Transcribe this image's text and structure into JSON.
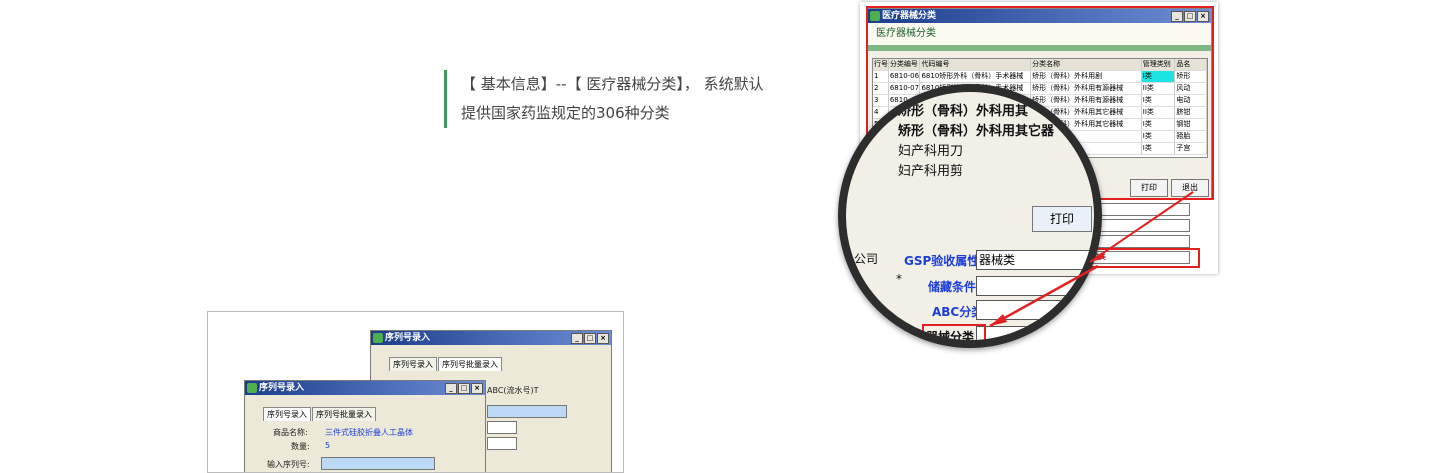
{
  "caption": {
    "line1": "【 基本信息】--【 医疗器械分类】， 系统默认",
    "line2": "提供国家药监规定的306种分类"
  },
  "right_window": {
    "title": "医疗器械分类",
    "header": "医疗器械分类",
    "columns": [
      "行号",
      "分类编号",
      "代码编号",
      "分类名称",
      "管理类别",
      "品名"
    ],
    "rows": [
      [
        "1",
        "6810-06",
        "6810矫形外科（骨科）手术器械",
        "矫形（骨科）外科用剧",
        "I类",
        "矫形"
      ],
      [
        "2",
        "6810-07",
        "6810矫形外科（骨科）手术器械",
        "矫形（骨科）外科用有源器械",
        "II类",
        "风动"
      ],
      [
        "3",
        "6810",
        "",
        "矫形（骨科）外科用有源器械",
        "I类",
        "电动"
      ],
      [
        "4",
        "",
        "",
        "矫形（骨科）外科用其它器械",
        "II类",
        "脐钳"
      ],
      [
        "5",
        "",
        "",
        "矫形（骨科）外科用其它器械",
        "I类",
        "钢钳"
      ],
      [
        "",
        "",
        "",
        "妇产科用刀",
        "I类",
        "箝胎"
      ],
      [
        "",
        "",
        "",
        "",
        "I类",
        "子宫"
      ]
    ],
    "print_label": "打印",
    "exit_label": "退出",
    "gsp_value": "器械类",
    "dropdown_value": "械类"
  },
  "magnifier": {
    "row1": "矫形（骨科）外科用其",
    "row2": "矫形（骨科）外科用其它器",
    "row3": "妇产科用刀",
    "row4": "妇产科用剪",
    "print_label": "打印",
    "company_tail": "公司",
    "gsp_label": "GSP验收属性",
    "gsp_value": "器械类",
    "storage_label": "储藏条件",
    "abc_label": "ABC分类",
    "device_label": "器械分类",
    "star": "*"
  },
  "left_window": {
    "title_back": "序列号录入",
    "title_front": "序列号录入",
    "tab1": "序列号录入",
    "tab2": "序列号批量录入",
    "abc_text": "ABC(流水号)T",
    "product_label": "商品名称:",
    "product_value": "三件式硅胶折叠人工晶体",
    "qty_label": "数量:",
    "qty_value": "5",
    "serial_label": "输入序列号:"
  },
  "colors": {
    "accent": "#3a9a5a",
    "highlight_red": "#e41f1f",
    "title_blue": "#1c3d8c"
  }
}
